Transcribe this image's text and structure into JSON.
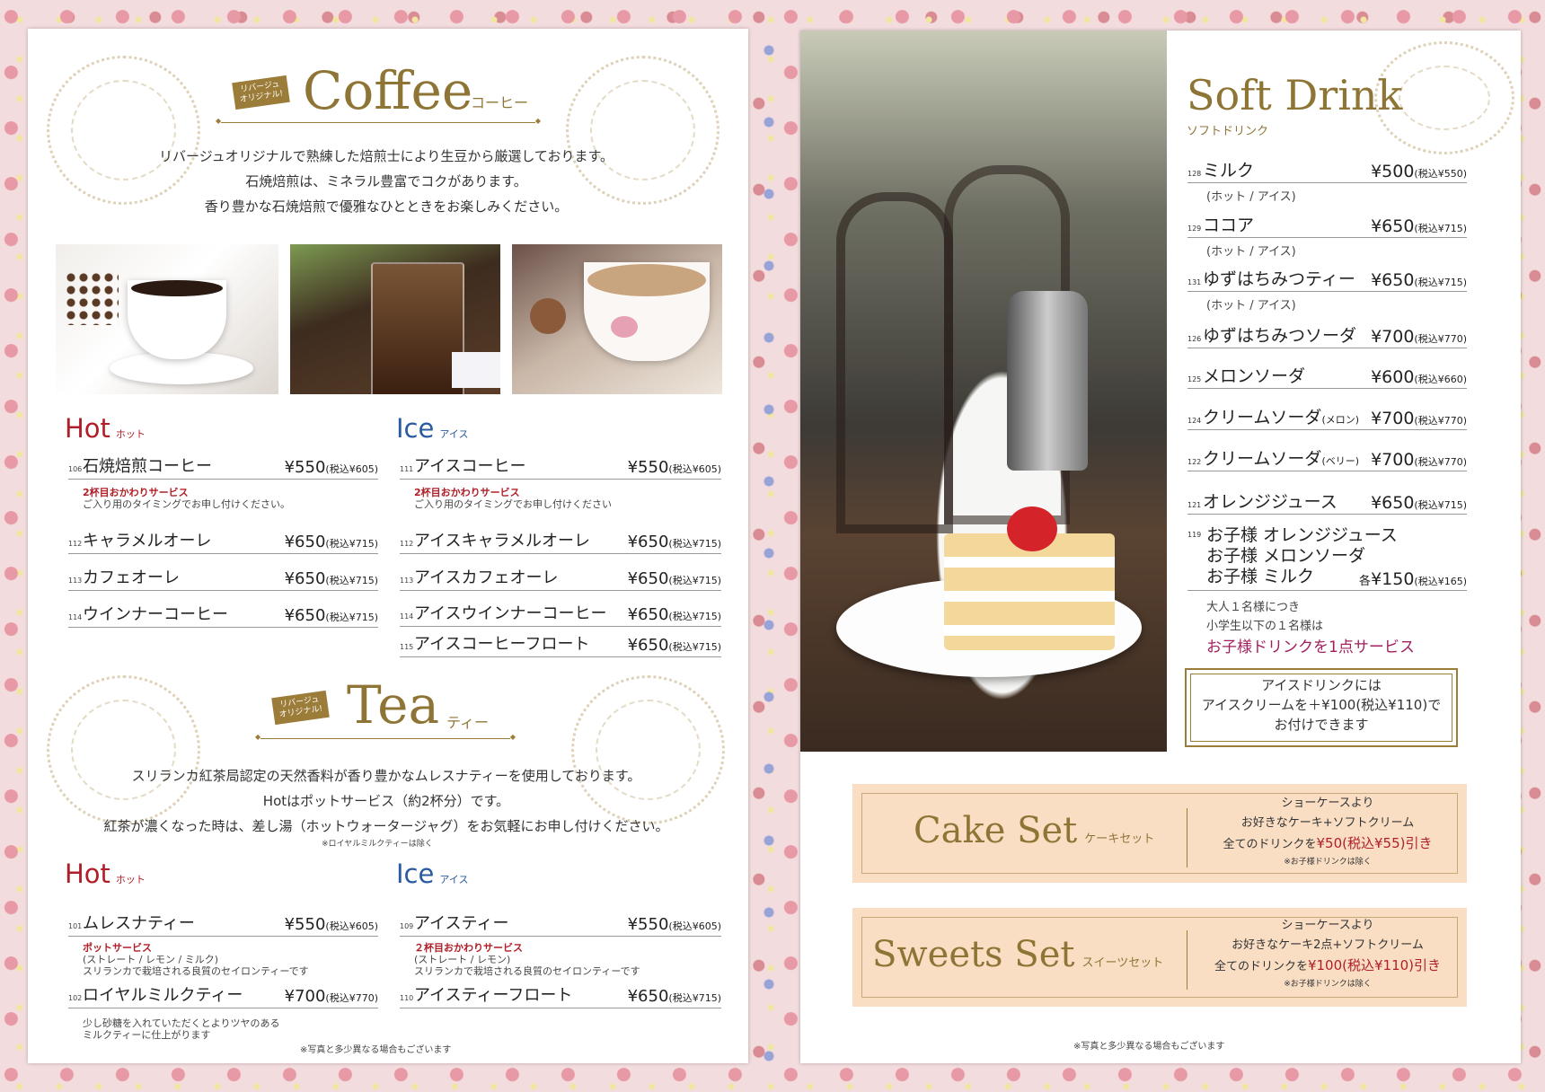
{
  "coffee": {
    "badge": "リバージュ\nオリジナル!",
    "title": "Coffee",
    "title_ja": "コーヒー",
    "intro": [
      "リバージュオリジナルで熟練した焙煎士により生豆から厳選しております。",
      "石焼焙煎は、ミネラル豊富でコクがあります。",
      "香り豊かな石焼焙煎で優雅なひとときをお楽しみください。"
    ],
    "hot_label": "Hot",
    "hot_label_ja": "ホット",
    "ice_label": "Ice",
    "ice_label_ja": "アイス",
    "hot": [
      {
        "num": "106",
        "name": "石焼焙煎コーヒー",
        "price": "¥550",
        "tax": "(税込¥605)"
      },
      {
        "num": "112",
        "name": "キャラメルオーレ",
        "price": "¥650",
        "tax": "(税込¥715)"
      },
      {
        "num": "113",
        "name": "カフェオーレ",
        "price": "¥650",
        "tax": "(税込¥715)"
      },
      {
        "num": "114",
        "name": "ウインナーコーヒー",
        "price": "¥650",
        "tax": "(税込¥715)"
      }
    ],
    "hot_note_red": "2杯目おかわりサービス",
    "hot_note": "ご入り用のタイミングでお申し付けください。",
    "ice": [
      {
        "num": "111",
        "name": "アイスコーヒー",
        "price": "¥550",
        "tax": "(税込¥605)"
      },
      {
        "num": "112",
        "name": "アイスキャラメルオーレ",
        "price": "¥650",
        "tax": "(税込¥715)"
      },
      {
        "num": "113",
        "name": "アイスカフェオーレ",
        "price": "¥650",
        "tax": "(税込¥715)"
      },
      {
        "num": "114",
        "name": "アイスウインナーコーヒー",
        "price": "¥650",
        "tax": "(税込¥715)"
      },
      {
        "num": "115",
        "name": "アイスコーヒーフロート",
        "price": "¥650",
        "tax": "(税込¥715)"
      }
    ],
    "ice_note_red": "2杯目おかわりサービス",
    "ice_note": "ご入り用のタイミングでお申し付けください"
  },
  "tea": {
    "badge": "リバージュ\nオリジナル!",
    "title": "Tea",
    "title_ja": "ティー",
    "intro": [
      "スリランカ紅茶局認定の天然香料が香り豊かなムレスナティーを使用しております。",
      "Hotはポットサービス（約2杯分）です。",
      "紅茶が濃くなった時は、差し湯（ホットウォータージャグ）をお気軽にお申し付けください。"
    ],
    "intro_small": "※ロイヤルミルクティーは除く",
    "hot_label": "Hot",
    "hot_label_ja": "ホット",
    "ice_label": "Ice",
    "ice_label_ja": "アイス",
    "hot": [
      {
        "num": "101",
        "name": "ムレスナティー",
        "price": "¥550",
        "tax": "(税込¥605)"
      },
      {
        "num": "102",
        "name": "ロイヤルミルクティー",
        "price": "¥700",
        "tax": "(税込¥770)"
      }
    ],
    "hot_note_red": "ポットサービス",
    "hot_note_1": "(ストレート / レモン / ミルク)",
    "hot_note_2": "スリランカで栽培される良質のセイロンティーです",
    "hot_note_3": "少し砂糖を入れていただくとよりツヤのある",
    "hot_note_4": "ミルクティーに仕上がります",
    "ice": [
      {
        "num": "109",
        "name": "アイスティー",
        "price": "¥550",
        "tax": "(税込¥605)"
      },
      {
        "num": "110",
        "name": "アイスティーフロート",
        "price": "¥650",
        "tax": "(税込¥715)"
      }
    ],
    "ice_note_red": "２杯目おかわりサービス",
    "ice_note_1": "(ストレート / レモン)",
    "ice_note_2": "スリランカで栽培される良質のセイロンティーです"
  },
  "left_footer": "※写真と多少異なる場合もございます",
  "soft": {
    "title": "Soft Drink",
    "title_ja": "ソフトドリンク",
    "items": [
      {
        "num": "128",
        "name": "ミルク",
        "price": "¥500",
        "tax": "(税込¥550)",
        "sub": "(ホット / アイス)"
      },
      {
        "num": "129",
        "name": "ココア",
        "price": "¥650",
        "tax": "(税込¥715)",
        "sub": "(ホット / アイス)"
      },
      {
        "num": "131",
        "name": "ゆずはちみつティー",
        "price": "¥650",
        "tax": "(税込¥715)",
        "sub": "(ホット / アイス)"
      },
      {
        "num": "126",
        "name": "ゆずはちみつソーダ",
        "price": "¥700",
        "tax": "(税込¥770)",
        "sub": ""
      },
      {
        "num": "125",
        "name": "メロンソーダ",
        "price": "¥600",
        "tax": "(税込¥660)",
        "sub": ""
      },
      {
        "num": "124",
        "name": "クリームソーダ",
        "name_small": "(メロン)",
        "price": "¥700",
        "tax": "(税込¥770)",
        "sub": ""
      },
      {
        "num": "122",
        "name": "クリームソーダ",
        "name_small": "(ベリー)",
        "price": "¥700",
        "tax": "(税込¥770)",
        "sub": ""
      },
      {
        "num": "121",
        "name": "オレンジジュース",
        "price": "¥650",
        "tax": "(税込¥715)",
        "sub": ""
      }
    ],
    "kids_num": "119",
    "kids_lines": [
      "お子様 オレンジジュース",
      "お子様 メロンソーダ",
      "お子様 ミルク"
    ],
    "kids_price_prefix": "各",
    "kids_price": "¥150",
    "kids_tax": "(税込¥165)",
    "kids_note_1": "大人１名様につき",
    "kids_note_2": "小学生以下の１名様は",
    "kids_note_red": "お子様ドリンクを1点サービス",
    "ice_box_1": "アイスドリンクには",
    "ice_box_2": "アイスクリームを＋¥100(税込¥110)で",
    "ice_box_3": "お付けできます"
  },
  "cake_set": {
    "title": "Cake Set",
    "title_ja": "ケーキセット",
    "line1": "ショーケースより",
    "line2": "お好きなケーキ+ソフトクリーム",
    "line3_a": "全てのドリンクを",
    "line3_b": "¥50(税込¥55)引き",
    "line4": "※お子様ドリンクは除く"
  },
  "sweets_set": {
    "title": "Sweets Set",
    "title_ja": "スイーツセット",
    "line1": "ショーケースより",
    "line2": "お好きなケーキ2点+ソフトクリーム",
    "line3_a": "全てのドリンクを",
    "line3_b": "¥100(税込¥110)引き",
    "line4": "※お子様ドリンクは除く"
  },
  "right_footer": "※写真と多少異なる場合もございます",
  "colors": {
    "gold": "#8e7536",
    "red": "#b01f28",
    "blue": "#2a5aa0",
    "set_bg": "#f9dec4"
  }
}
